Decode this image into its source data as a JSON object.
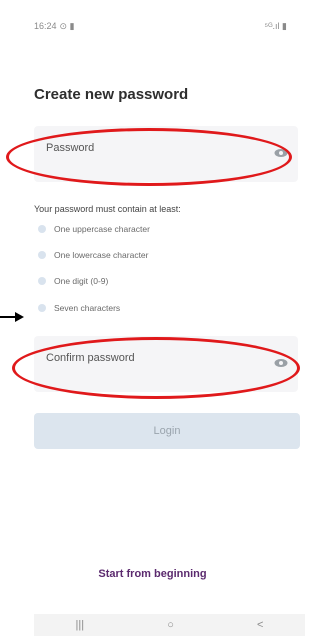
{
  "status_bar": {
    "time": "16:24",
    "left_icons": "⊙ ▮",
    "right_icons": "⁵ᴳ.ıl ▮"
  },
  "page_title": "Create new password",
  "password_field": {
    "label": "Password"
  },
  "requirements": {
    "title": "Your password must contain at least:",
    "items": [
      "One uppercase character",
      "One lowercase character",
      "One digit (0-9)",
      "Seven characters"
    ]
  },
  "confirm_field": {
    "label": "Confirm password"
  },
  "login_button": {
    "label": "Login"
  },
  "start_link": {
    "label": "Start from beginning"
  },
  "nav": {
    "recents": "|||",
    "home": "○",
    "back": "<"
  },
  "colors": {
    "annotation_red": "#e0191b",
    "link_purple": "#5b2a6e",
    "button_disabled": "#dce5ee"
  }
}
